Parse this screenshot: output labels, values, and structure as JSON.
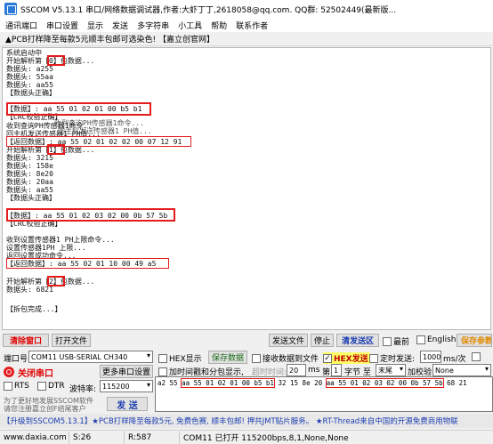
{
  "window": {
    "title": "SSCOM V5.13.1 串口/网络数据调试器,作者:大虾丁丁,2618058@qq.com. QQ群: 52502449(最新版..."
  },
  "menu": [
    "通讯端口",
    "串口设置",
    "显示",
    "发送",
    "多字符串",
    "小工具",
    "帮助",
    "联系作者"
  ],
  "ad": "▲PCB打样降至每款5元顺丰包邮可选染色! 【嘉立创官网】",
  "recv_lines": [
    "系统启动中",
    "开始解析第【0】包数据...",
    "数据头: a255",
    "数据头: 55aa",
    "数据头: aa55",
    "【数据头正确】",
    "",
    "【数据】: aa 55 01 02 01 00 b5 b1",
    "【CRC校验正确】",
    "收到查询PH传感器1命令...",
    "回主机发送传感器1 PH值...",
    "【返回数据】: aa 55 02 01 02 02 00 07 12 91",
    "开始解析第【1】包数据...",
    "数据头: 3215",
    "数据头: 158e",
    "数据头: 8e20",
    "数据头: 20aa",
    "数据头: aa55",
    "【数据头正确】",
    "",
    "【数据】: aa 55 01 02 03 02 00 0b 57 5b",
    "【CRC校验正确】",
    "",
    "收到设置传感器1 PH上限命令...",
    "设置传感器1PH 上限...",
    "返回设置成功命令...",
    "【返回数据】: aa 55 02 01 10 00 49 a5",
    "",
    "开始解析第【2】包数据...",
    "数据头: 6821",
    "",
    "【拆包完成...】"
  ],
  "overlay": {
    "recv_ph": "收到查询PH传感器1命令...",
    "send_ph": "回主机发送传感器1 PH值..."
  },
  "toolbar": {
    "clear_window": "清除窗口",
    "open_file": "打开文件",
    "send_file": "发送文件",
    "stop": "停止",
    "clear_send": "清发送区",
    "topmost": "最前",
    "english": "English",
    "save_params": "保存参数"
  },
  "settings": {
    "port_label": "端口号",
    "port_value": "COM11 USB-SERIAL CH340",
    "more_settings": "更多串口设置",
    "close_port": "关闭串口",
    "rts": "RTS",
    "dtr": "DTR",
    "baud_label": "波特率:",
    "baud_value": "115200",
    "hex_display": "HEX显示",
    "save_data": "保存数据",
    "recv_to_file": "接收数据到文件",
    "hex_send": "HEX发送",
    "timed_send": "定时发送:",
    "interval": "1000",
    "interval_unit": "ms/次",
    "add_timestamp": "加时间戳和分包显示,",
    "timeout_label": "超时时间:",
    "timeout_value": "20",
    "timeout_unit": "ms",
    "byte_index_label": "第",
    "byte_index_value": "1",
    "byte_label": "字节 至",
    "end_value": "末尾",
    "checksum_label": "加校验",
    "checksum_value": "None",
    "send_button": "发 送",
    "promo_line1": "为了更好地发展SSCOM软件",
    "promo_line2": "请您注册嘉立创F结尾客户",
    "send_text": [
      "a2 55 ",
      "aa 55 01 02 01 00 b5 b1",
      " 32 15 8e 20 ",
      "aa 55 01 02 03 02 00 0b 57 5b",
      " 68 21"
    ]
  },
  "marquee": "【升级到SSCOM5.13.1】★PCB打样降至每款5元, 免费色赛, 顺丰包邮! 押共JMT贴片服务。 ★RT-Thread来自中国的开源免费商用物联",
  "status": {
    "site": "www.daxia.com",
    "sent": "S:26",
    "received": "R:587",
    "port_status": "COM11 已打开  115200bps,8,1,None,None"
  }
}
